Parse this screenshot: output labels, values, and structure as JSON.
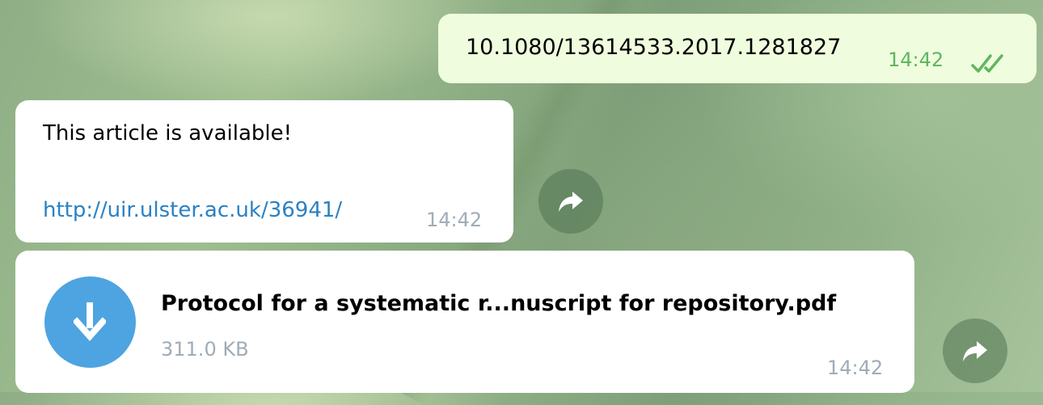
{
  "messages": {
    "outgoing": {
      "text": "10.1080/13614533.2017.1281827",
      "time": "14:42",
      "status_icon": "double-check-icon"
    },
    "link_message": {
      "text": "This article is available!",
      "link": "http://uir.ulster.ac.uk/36941/",
      "time": "14:42"
    },
    "file_message": {
      "file_name": "Protocol for a systematic r...nuscript for repository.pdf",
      "file_size": "311.0 KB",
      "time": "14:42",
      "icon": "download-icon"
    }
  },
  "colors": {
    "outgoing_bubble": "#effdde",
    "incoming_bubble": "#ffffff",
    "link": "#2a81c4",
    "outgoing_time": "#5fb65f",
    "incoming_time": "#a0acb6",
    "download_circle": "#4ea4e0"
  }
}
